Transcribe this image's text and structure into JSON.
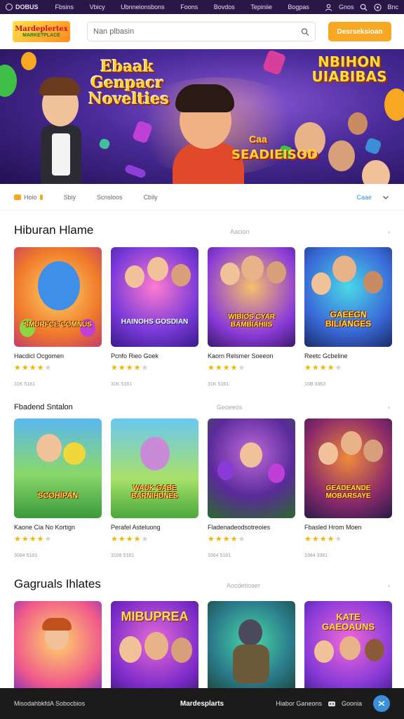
{
  "topbar": {
    "brand": "DOBUS",
    "nav": [
      "Fbsins",
      "Vbicy",
      "Ubnneionsbons",
      "Foons",
      "Bovdos",
      "Tepiniie",
      "Bogpas"
    ],
    "account": "Gnos",
    "lang": "Bnc"
  },
  "header": {
    "logo_line1": "Mardeplertex",
    "logo_line2": "MARKETPLACE",
    "search_placeholder": "Nan plbasin",
    "cta_label": "Desrseksioan"
  },
  "hero": {
    "title_left": "Ebaak Genpacr Novelties",
    "title_right": "NBIHON UIABIBAS",
    "title_center_small": "Caa",
    "title_center": "SEADIEISOD"
  },
  "filters": {
    "items": [
      "Hoio",
      "Sbiy",
      "Scnsloos",
      "Cbily"
    ],
    "right_label": "Caae"
  },
  "sections": [
    {
      "title": "Hiburan Hlame",
      "more": "Aacion",
      "cards": [
        {
          "title": "Hacdicl Ocgomen",
          "thumb_text": "SMURFCE COMNUS",
          "rating": 4,
          "meta": "31K 5181"
        },
        {
          "title": "Pcnfo Rieo Goek",
          "thumb_text": "HAINOHS GOSDIAN",
          "rating": 4,
          "meta": "31K 5181"
        },
        {
          "title": "Kaorn Relsmer Soeeon",
          "thumb_text": "WIBIOS CYAR BAMBIAHIIS",
          "rating": 4,
          "meta": "31K 5181"
        },
        {
          "title": "Reetc Gcbeline",
          "thumb_text": "GAEEGN BILIANGES",
          "rating": 4,
          "meta": "10B 3363"
        }
      ]
    },
    {
      "title": "Fbadend Sntalon",
      "more": "Geoeeos",
      "cards": [
        {
          "title": "Kaone Cia No Kortign",
          "thumb_text": "SCOHIPAN",
          "rating": 4,
          "meta": "3084 5181"
        },
        {
          "title": "Perafel Asteluong",
          "thumb_text": "WAUK GABE BARNIHDNES",
          "rating": 4,
          "meta": "3108 5181"
        },
        {
          "title": "Fladenadeodsotreoies",
          "thumb_text": "",
          "rating": 4,
          "meta": "3364 5181"
        },
        {
          "title": "Fbasled Hrom Moen",
          "thumb_text": "GEADEANDE MOBARSAYE",
          "rating": 4,
          "meta": "3384 3381"
        }
      ]
    },
    {
      "title": "Gagruals Ihlates",
      "more": "Aocdetioaer",
      "cards": [
        {
          "title": "",
          "thumb_text": "",
          "rating": 0,
          "meta": ""
        },
        {
          "title": "",
          "thumb_text": "MIBUPREA",
          "rating": 0,
          "meta": ""
        },
        {
          "title": "",
          "thumb_text": "",
          "rating": 0,
          "meta": ""
        },
        {
          "title": "",
          "thumb_text": "KATE GAEOAUNS",
          "rating": 0,
          "meta": ""
        }
      ]
    }
  ],
  "bottom": {
    "left": "MisodahbkfdA Sobocbios",
    "center": "Mardesplarts",
    "right1": "Hiabor Ganeons",
    "right2": "Goonia"
  },
  "colors": {
    "topbar": "#2a1647",
    "accent": "#f6a823",
    "link": "#3a8fd8",
    "star": "#f4b400"
  }
}
